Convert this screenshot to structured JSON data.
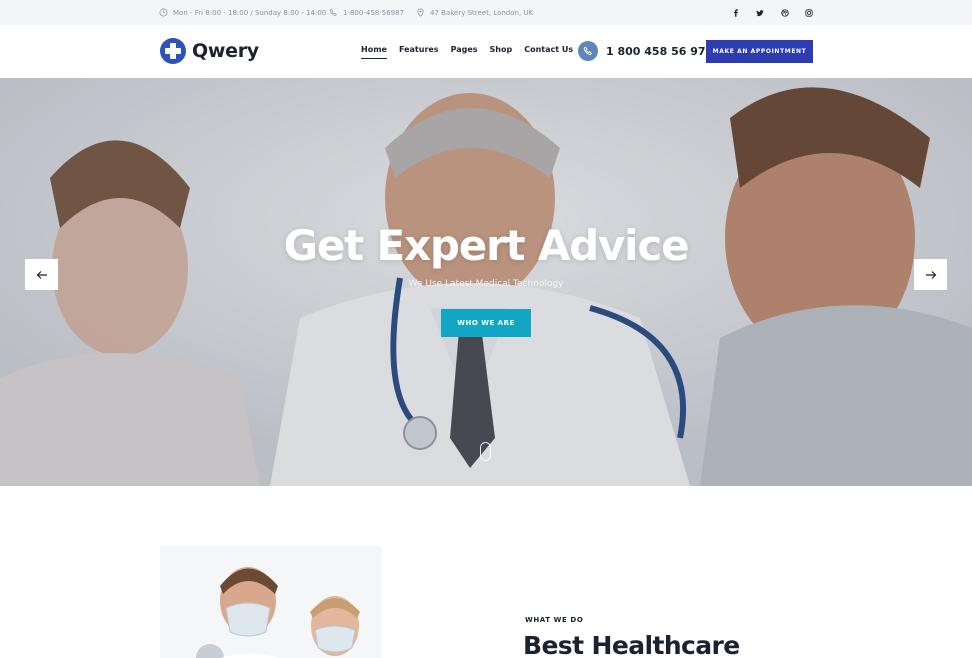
{
  "topbar": {
    "hours": "Mon - Fri 8:00 - 18:00  /  Sunday 8:00 - 14:00",
    "phone": "1-800-458-56987",
    "address": "47 Bakery Street, London, UK",
    "social_icons": [
      "facebook-icon",
      "twitter-icon",
      "dribbble-icon",
      "instagram-icon"
    ]
  },
  "header": {
    "logo_text": "Qwery",
    "nav": [
      {
        "label": "Home",
        "active": true
      },
      {
        "label": "Features",
        "active": false
      },
      {
        "label": "Pages",
        "active": false
      },
      {
        "label": "Shop",
        "active": false
      },
      {
        "label": "Contact Us",
        "active": false
      }
    ],
    "phone_number": "1 800 458 56 97",
    "cta_label": "MAKE AN APPOINTMENT"
  },
  "hero": {
    "title": "Get Expert Advice",
    "subtitle": "We Use Latest Medical Technology",
    "button_label": "WHO WE ARE",
    "prev_icon": "arrow-left-icon",
    "next_icon": "arrow-right-icon"
  },
  "section": {
    "eyebrow": "WHAT WE DO",
    "title": "Best Healthcare"
  },
  "colors": {
    "brand_blue": "#2a54b6",
    "cta_blue": "#2d3cae",
    "hero_button": "#13a5c4",
    "text_dark": "#1b2230"
  }
}
